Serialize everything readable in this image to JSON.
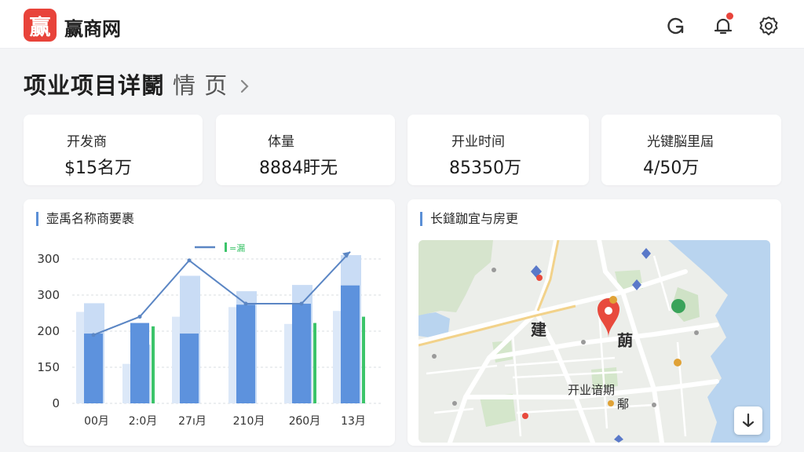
{
  "app": {
    "logo_char": "赢",
    "name": "赢商网"
  },
  "header": {
    "title": "项业项目详鬭",
    "crumb": "情 页"
  },
  "stats": [
    {
      "label": "开发商",
      "value": "$15名万"
    },
    {
      "label": "体量",
      "value": "8884盱无"
    },
    {
      "label": "开业时间",
      "value": "85350万"
    },
    {
      "label": "光键脳里屆",
      "value": "4/50万"
    }
  ],
  "chart_panel": {
    "title": "壶禹名称商要裹"
  },
  "chart_data": {
    "type": "bar",
    "categories": [
      "00月",
      "2:0月",
      "27ı月",
      "210月",
      "2б0月",
      "13月"
    ],
    "yticks": [
      "300",
      "300",
      "200",
      "150",
      "0"
    ],
    "ylim": [
      0,
      300
    ],
    "legend": [
      {
        "name": "",
        "symbol": "line",
        "color": "#5b86c4"
      },
      {
        "name": "=漏",
        "symbol": "bar",
        "color": "#3cc46a"
      }
    ],
    "series": [
      {
        "name": "",
        "type": "bar",
        "values": [
          208,
          122,
          265,
          233,
          246,
          308
        ],
        "color": "#c9dcf5"
      },
      {
        "name": "",
        "type": "bar",
        "values": [
          190,
          82,
          180,
          200,
          165,
          192
        ],
        "color": "#dce8f8"
      },
      {
        "name": "",
        "type": "bar",
        "values": [
          145,
          167,
          145,
          205,
          207,
          245
        ],
        "color": "#5d92dd"
      },
      {
        "name": "",
        "type": "bar",
        "values": [
          0,
          160,
          0,
          0,
          167,
          180
        ],
        "color": "#3cc46a"
      },
      {
        "name": "",
        "type": "line",
        "values": [
          142,
          180,
          297,
          207,
          207,
          315
        ],
        "color": "#5b86c4"
      }
    ]
  },
  "map_panel": {
    "title": "长鏠跏宜与房更",
    "labels": {
      "left": "建",
      "right": "蓢",
      "district": "开业谙期",
      "sub": "鄅"
    }
  },
  "icons": {
    "refresh": "refresh-icon",
    "bell": "bell-icon",
    "settings": "gear-icon",
    "map_pin": "map-pin-icon",
    "locate": "locate-icon"
  },
  "colors": {
    "brand": "#e8433a",
    "accent": "#5b8fd6",
    "bar_dark": "#5d92dd",
    "bar_light": "#c9dcf5",
    "green": "#3cc46a",
    "water": "#b9d4ef"
  }
}
